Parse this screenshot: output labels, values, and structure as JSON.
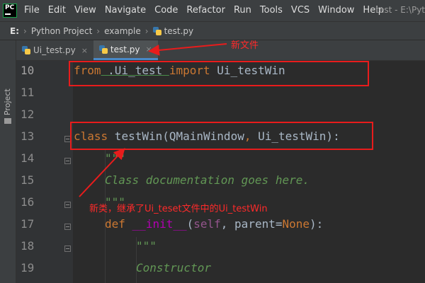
{
  "app": {
    "logo_text": "PC",
    "menu": [
      "File",
      "Edit",
      "View",
      "Navigate",
      "Code",
      "Refactor",
      "Run",
      "Tools",
      "VCS",
      "Window",
      "Help"
    ],
    "window_title": "test - E:\\Pyt"
  },
  "breadcrumb": {
    "drive": "E:",
    "project": "Python Project",
    "folder": "example",
    "file": "test.py"
  },
  "sidebar": {
    "label": "Project"
  },
  "tabs": [
    {
      "label": "Ui_test.py",
      "close": "×"
    },
    {
      "label": "test.py",
      "close": "×"
    }
  ],
  "editor": {
    "line_numbers": [
      "10",
      "11",
      "12",
      "13",
      "14",
      "15",
      "16",
      "17",
      "18",
      "19"
    ],
    "line10": {
      "kw1": "from",
      "mod": " .Ui_test ",
      "kw2": "import",
      "name": " Ui_testWin"
    },
    "line13": {
      "kw": "class",
      "name": " testWin(QMainWindow",
      "comma": ",",
      "base": " Ui_testWin):"
    },
    "line14": "\"\"\"",
    "line15": "Class documentation goes here.",
    "line16": "\"\"\"",
    "line17": {
      "kw": "def",
      "sp": " ",
      "name": "__init__",
      "open": "(",
      "self": "self",
      "rest": ", parent=",
      "none": "None",
      "close": "):"
    },
    "line18": "\"\"\"",
    "line19": "Constructor"
  },
  "annotations": {
    "new_file": "新文件",
    "new_class": "新类，继承了Ui_teset文件中的Ui_testWin"
  },
  "colors": {
    "annotation_red": "#e81c1c",
    "keyword": "#cc7832",
    "docstring": "#629755",
    "tab_underline": "#4a88c7"
  }
}
